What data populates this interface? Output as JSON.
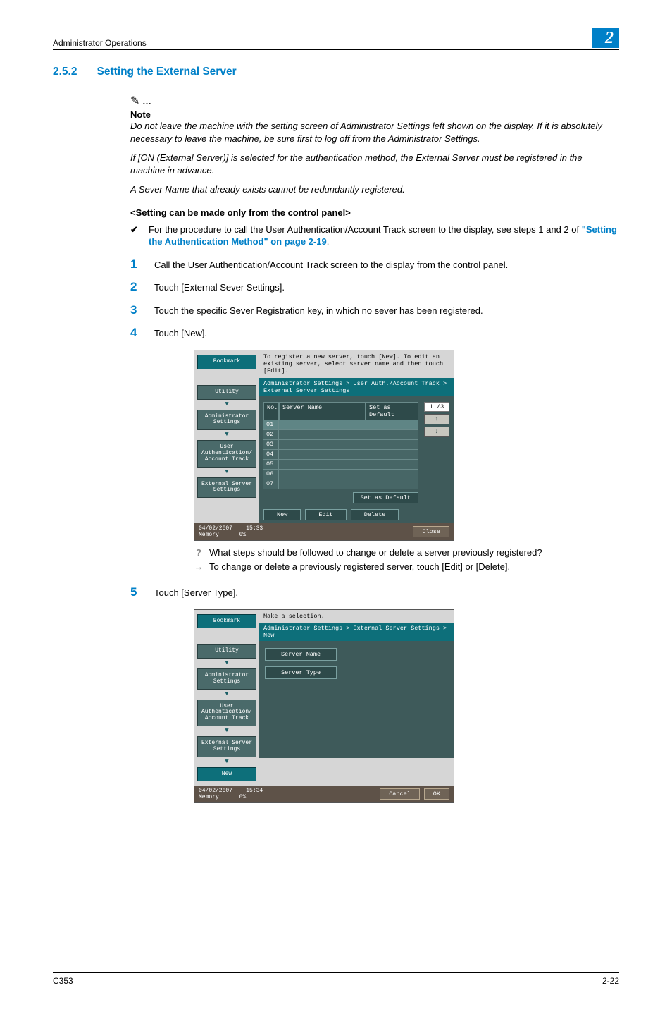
{
  "header": {
    "section_label": "Administrator Operations",
    "chapter_number": "2"
  },
  "section": {
    "number": "2.5.2",
    "title": "Setting the External Server"
  },
  "note": {
    "label": "Note",
    "paragraphs": [
      "Do not leave the machine with the setting screen of Administrator Settings left shown on the display. If it is absolutely necessary to leave the machine, be sure first to log off from the Administrator Settings.",
      "If [ON (External Server)] is selected for the authentication method, the External Server must be registered in the machine in advance.",
      "A Sever Name that already exists cannot be redundantly registered."
    ]
  },
  "panel_only_heading": "<Setting can be made only from the control panel>",
  "check_item": {
    "text_before_link": "For the procedure to call the User Authentication/Account Track screen to the display, see steps 1 and 2 of ",
    "link_text": "\"Setting the Authentication Method\" on page 2-19",
    "text_after_link": "."
  },
  "steps": [
    {
      "num": "1",
      "text": "Call the User Authentication/Account Track screen to the display from the control panel."
    },
    {
      "num": "2",
      "text": "Touch [External Sever Settings]."
    },
    {
      "num": "3",
      "text": "Touch the specific Sever Registration key, in which no sever has been registered."
    },
    {
      "num": "4",
      "text": "Touch [New]."
    },
    {
      "num": "5",
      "text": "Touch [Server Type]."
    }
  ],
  "shot1": {
    "instruction": "To register a new server, touch [New]. To edit an existing server, select server name and then touch [Edit].",
    "breadcrumb": "Administrator Settings > User Auth./Account Track > External Server Settings",
    "nav": {
      "bookmark": "Bookmark",
      "utility": "Utility",
      "admin": "Administrator Settings",
      "userauth": "User Authentication/ Account Track",
      "extserver": "External Server Settings"
    },
    "table": {
      "col_no": "No.",
      "col_name": "Server Name",
      "col_default": "Set as Default",
      "rows": [
        "01",
        "02",
        "03",
        "04",
        "05",
        "06",
        "07"
      ],
      "pager": {
        "label": "1 /3",
        "up": "↑",
        "down": "↓"
      }
    },
    "buttons": {
      "set_default": "Set as Default",
      "new": "New",
      "edit": "Edit",
      "delete": "Delete",
      "close": "Close"
    },
    "status": {
      "date": "04/02/2007",
      "time": "15:33",
      "mem_label": "Memory",
      "mem_val": "0%"
    }
  },
  "qa": {
    "question": "What steps should be followed to change or delete a server previously registered?",
    "answer": "To change or delete a previously registered server, touch [Edit] or [Delete]."
  },
  "shot2": {
    "instruction": "Make a selection.",
    "breadcrumb": "Administrator Settings > External Server Settings > New",
    "nav": {
      "bookmark": "Bookmark",
      "utility": "Utility",
      "admin": "Administrator Settings",
      "userauth": "User Authentication/ Account Track",
      "extserver": "External Server Settings",
      "new": "New"
    },
    "buttons": {
      "server_name": "Server Name",
      "server_type": "Server Type",
      "cancel": "Cancel",
      "ok": "OK"
    },
    "status": {
      "date": "04/02/2007",
      "time": "15:34",
      "mem_label": "Memory",
      "mem_val": "0%"
    }
  },
  "footer": {
    "left": "C353",
    "right": "2-22"
  }
}
